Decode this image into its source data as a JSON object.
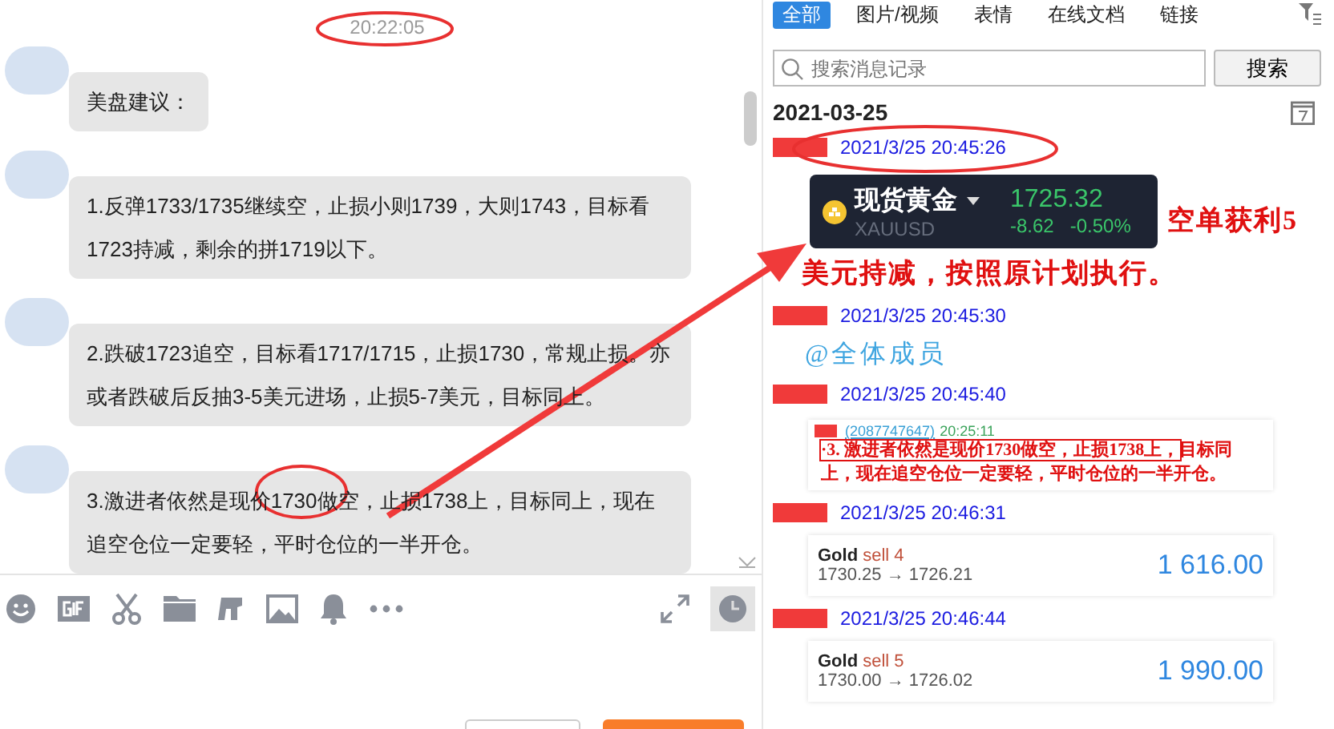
{
  "chat": {
    "timestamp": "20:22:05",
    "messages": [
      {
        "text": "美盘建议："
      },
      {
        "text": "1.反弹1733/1735继续空，止损小则1739，大则1743，目标看1723持减，剩余的拼1719以下。"
      },
      {
        "text": "2.跌破1723追空，目标看1717/1715，止损1730，常规止损。亦或者跌破后反抽3-5美元进场，止损5-7美元，目标同上。"
      },
      {
        "text": "3.激进者依然是现价1730做空，止损1738上，目标同上，现在追空仓位一定要轻，平时仓位的一半开仓。"
      }
    ]
  },
  "history": {
    "tabs": [
      {
        "label": "全部",
        "selected": true
      },
      {
        "label": "图片/视频",
        "selected": false
      },
      {
        "label": "表情",
        "selected": false
      },
      {
        "label": "在线文档",
        "selected": false
      },
      {
        "label": "链接",
        "selected": false
      }
    ],
    "search": {
      "placeholder": "搜索消息记录",
      "button": "搜索"
    },
    "date": "2021-03-25",
    "entries": [
      {
        "time": "2021/3/25 20:45:26",
        "kind": "ticker",
        "name": "现货黄金",
        "symbol": "XAUUSD",
        "price": "1725.32",
        "change": "-8.62",
        "percent": "-0.50%"
      },
      {
        "time": "2021/3/25 20:45:30",
        "kind": "mention",
        "text": "@全体成员"
      },
      {
        "time": "2021/3/25 20:45:40",
        "kind": "quote",
        "sender_id": "(2087747647)",
        "quote_time": "20:25:11",
        "highlight": "·3. 激进者依然是现价1730做空，止损1738上，",
        "text": "目标同上，现在追空仓位一定要轻，平时仓位的一半开仓。"
      },
      {
        "time": "2021/3/25 20:46:31",
        "kind": "trade",
        "instrument": "Gold",
        "side": "sell 4",
        "route": "1730.25 → 1726.21",
        "amount": "1 616.00"
      },
      {
        "time": "2021/3/25 20:46:44",
        "kind": "trade",
        "instrument": "Gold",
        "side": "sell 5",
        "route": "1730.00 → 1726.02",
        "amount": "1 990.00"
      }
    ]
  },
  "annotation": {
    "lines": [
      "空单获利5",
      "美元持减，按照原计划执行。"
    ]
  }
}
